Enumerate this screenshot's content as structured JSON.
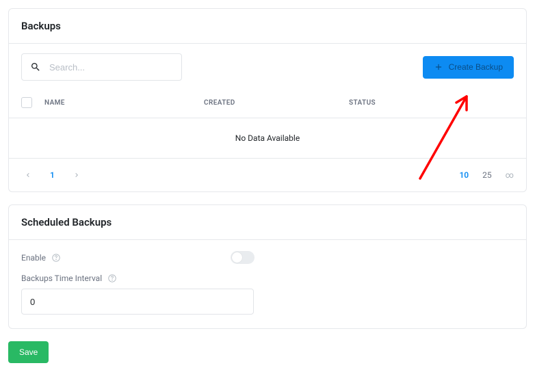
{
  "backups_card": {
    "title": "Backups",
    "search_placeholder": "Search...",
    "create_button_label": "Create Backup",
    "columns": {
      "name": "NAME",
      "created": "CREATED",
      "status": "STATUS"
    },
    "no_data_message": "No Data Available",
    "pagination": {
      "current_page": "1",
      "page_size_active": "10",
      "page_size_25": "25",
      "page_size_infinity": "∞"
    }
  },
  "scheduled_card": {
    "title": "Scheduled Backups",
    "enable_label": "Enable",
    "enable_value": false,
    "interval_label": "Backups Time Interval",
    "interval_value": "0"
  },
  "save_button_label": "Save"
}
